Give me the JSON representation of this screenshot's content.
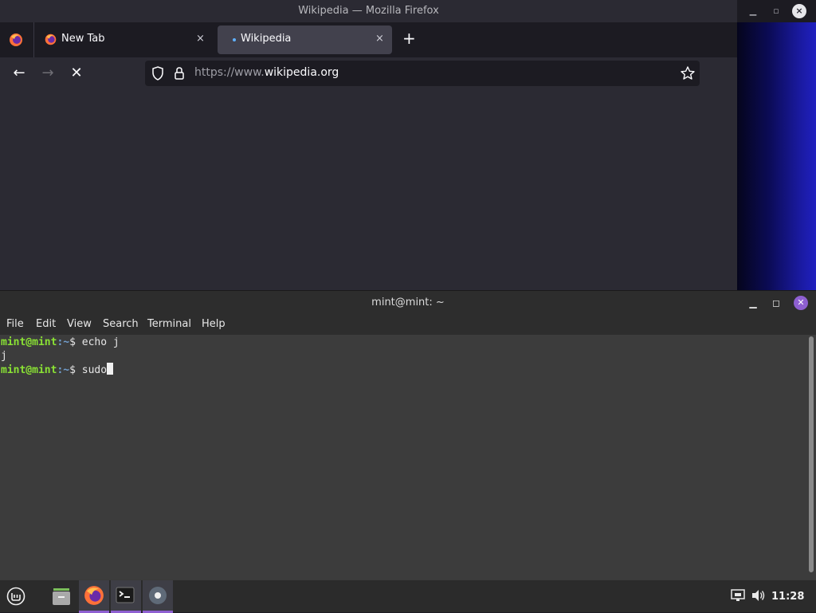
{
  "firefox": {
    "window_title": "Wikipedia — Mozilla Firefox",
    "tabs": [
      {
        "label": "New Tab",
        "close": "×"
      },
      {
        "label": "Wikipedia",
        "close": "×"
      }
    ],
    "new_tab_label": "+",
    "url": {
      "prefix": "https://www.",
      "domain": "wikipedia.org"
    }
  },
  "terminal": {
    "window_title": "mint@mint: ~",
    "menu": [
      "File",
      "Edit",
      "View",
      "Search",
      "Terminal",
      "Help"
    ],
    "lines": [
      {
        "user": "mint@mint",
        "path": ":~",
        "symbol": "$ ",
        "cmd": "echo j"
      },
      {
        "output": "j"
      },
      {
        "user": "mint@mint",
        "path": ":~",
        "symbol": "$ ",
        "cmd": "sudo"
      }
    ]
  },
  "taskbar": {
    "clock": "11:28",
    "accent": "#8e5fd1"
  },
  "icons": [
    "mint-menu-icon",
    "files-icon",
    "firefox-icon",
    "terminal-icon",
    "settings-icon",
    "network-icon",
    "volume-icon"
  ]
}
